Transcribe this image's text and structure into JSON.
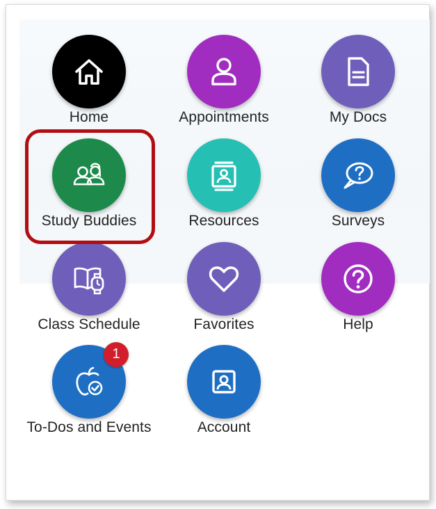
{
  "colors": {
    "home": "#000000",
    "purple": "#a12cc0",
    "lavender": "#6f5fba",
    "green": "#1d8a4b",
    "teal": "#26bfb4",
    "blue": "#1e6fc3",
    "highlight": "#b20e12",
    "badge": "#d11e2a"
  },
  "apps": [
    {
      "label": "Home",
      "icon": "home-icon"
    },
    {
      "label": "Appointments",
      "icon": "person-icon"
    },
    {
      "label": "My Docs",
      "icon": "document-icon"
    },
    {
      "label": "Study Buddies",
      "icon": "people-icon"
    },
    {
      "label": "Resources",
      "icon": "contact-card-icon"
    },
    {
      "label": "Surveys",
      "icon": "speech-bubble-question-icon"
    },
    {
      "label": "Class Schedule",
      "icon": "book-clock-icon"
    },
    {
      "label": "Favorites",
      "icon": "heart-icon"
    },
    {
      "label": "Help",
      "icon": "question-circle-icon"
    },
    {
      "label": "To-Dos and Events",
      "icon": "apple-check-icon",
      "badge": "1"
    },
    {
      "label": "Account",
      "icon": "account-portrait-icon"
    }
  ]
}
